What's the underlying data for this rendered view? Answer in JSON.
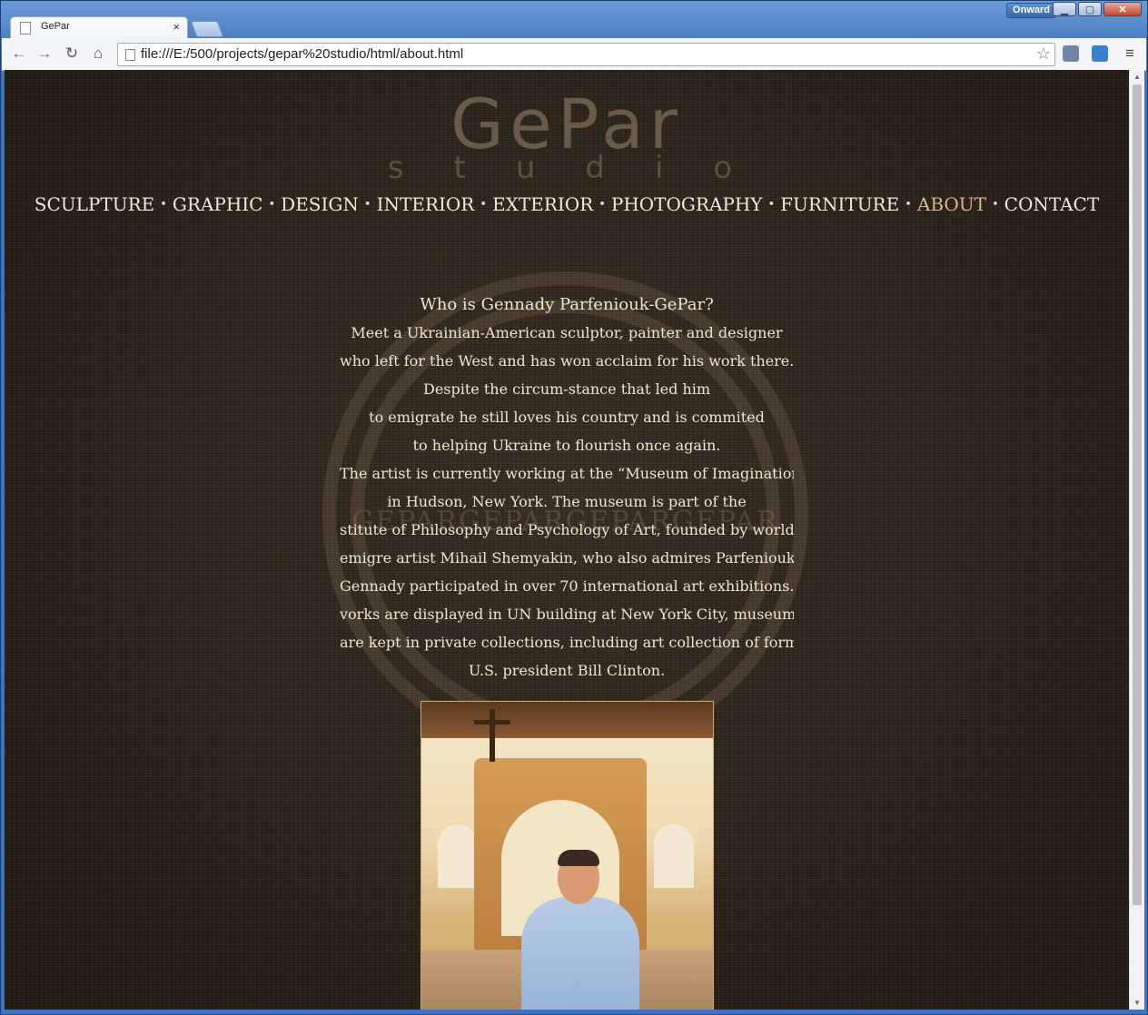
{
  "browser": {
    "profile_label": "Onward",
    "tab_title": "GePar",
    "url": "file:///E:/500/projects/gepar%20studio/html/about.html"
  },
  "site": {
    "logo_text": "GePar",
    "logo_subtext": "studio",
    "nav": {
      "sculpture": "SCULPTURE",
      "graphic": "GRAPHIC",
      "design": "DESIGN",
      "interior": "INTERIOR",
      "exterior": "EXTERIOR",
      "photography": "PHOTOGRAPHY",
      "furniture": "FURNITURE",
      "about": "ABOUT",
      "contact": "CONTACT",
      "separator": "•"
    },
    "seal_text": "GEPARGEPARGEPARGEPAR",
    "about_lines": [
      "Who is Gennady Parfeniouk-GePar?",
      "Meet a Ukrainian-American sculptor,  painter and designer",
      "who left for the West and has won acclaim for his work there.",
      "Despite the circum-stance that led him",
      "to emigrate he still loves his country and  is commited",
      "to helping Ukraine to flourish once again.",
      "The artist is currently working at the “Museum of Imagination”",
      "in Hudson, New York. The museum is part of the",
      "stitute of Philosophy and Psychology of Art, founded by worldwi",
      "emigre artist Mihail Shemyakin, who also admires Parfeniouk’s",
      "Gennady participated in over 70 international art exhibitions.",
      "vorks are displayed in UN building at New York City, museums",
      "are kept in private collections, including art collection of former",
      "U.S. president Bill Clinton."
    ]
  }
}
